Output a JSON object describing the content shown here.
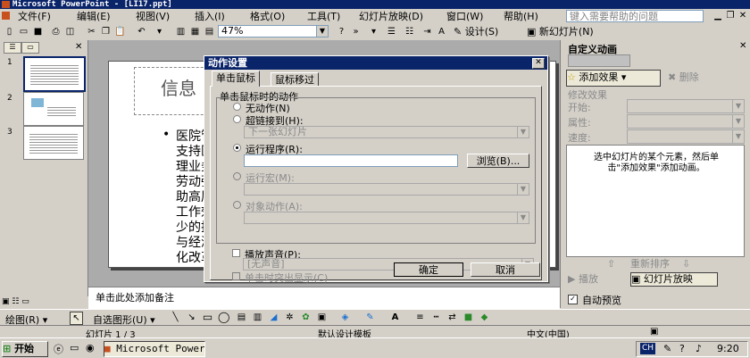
{
  "window": {
    "title": "Microsoft PowerPoint - [LI17.ppt]"
  },
  "menu": {
    "items": [
      "文件(F)",
      "编辑(E)",
      "视图(V)",
      "插入(I)",
      "格式(O)",
      "工具(T)",
      "幻灯片放映(D)",
      "窗口(W)",
      "帮助(H)"
    ],
    "help_placeholder": "键入需要帮助的问题"
  },
  "toolbar": {
    "zoom": "47%",
    "design_label": "设计(S)",
    "new_slide_label": "新幻灯片(N)"
  },
  "outline": {
    "slide_numbers": [
      "1",
      "2",
      "3"
    ]
  },
  "slide": {
    "title": "信息",
    "bullet": "•",
    "body_lines": [
      "医院管",
      "支持医",
      "理业务",
      "劳动强",
      "助高层",
      "工作效",
      "少的技",
      "与经济",
      "化改革"
    ]
  },
  "notes": {
    "placeholder": "单击此处添加备注"
  },
  "taskpane": {
    "title": "自定义动画",
    "add_effect": "添加效果",
    "delete": "删除",
    "modify_label": "修改效果",
    "start_label": "开始:",
    "property_label": "属性:",
    "speed_label": "速度:",
    "hint": "选中幻灯片的某个元素，然后单击\"添加效果\"添加动画。",
    "reorder": "重新排序",
    "play": "播放",
    "slideshow": "幻灯片放映",
    "autopreview": "自动预览"
  },
  "dialog": {
    "title": "动作设置",
    "tabs": [
      "单击鼠标",
      "鼠标移过"
    ],
    "group_label": "单击鼠标时的动作",
    "none_label": "无动作(N)",
    "hyperlink_label": "超链接到(H):",
    "hyperlink_value": "下一张幻灯片",
    "run_label": "运行程序(R):",
    "run_value": "",
    "browse_label": "浏览(B)...",
    "macro_label": "运行宏(M):",
    "object_label": "对象动作(A):",
    "sound_label": "播放声音(P):",
    "sound_value": "[无声音]",
    "highlight_label": "单击时突出显示(C)",
    "ok_label": "确定",
    "cancel_label": "取消"
  },
  "drawbar": {
    "draw_label": "绘图(R)",
    "autoshapes_label": "自选图形(U)"
  },
  "status": {
    "slide_info": "幻灯片 1 / 3",
    "design": "默认设计模板",
    "language": "中文(中国)"
  },
  "taskbar": {
    "start": "开始",
    "app_button": "Microsoft PowerPoin...",
    "lang_indicator": "CH",
    "time": "9:20"
  },
  "colors": {
    "titlebar": "#0a246a",
    "face": "#d4d0c8",
    "slide_bg": "#ffffff"
  }
}
